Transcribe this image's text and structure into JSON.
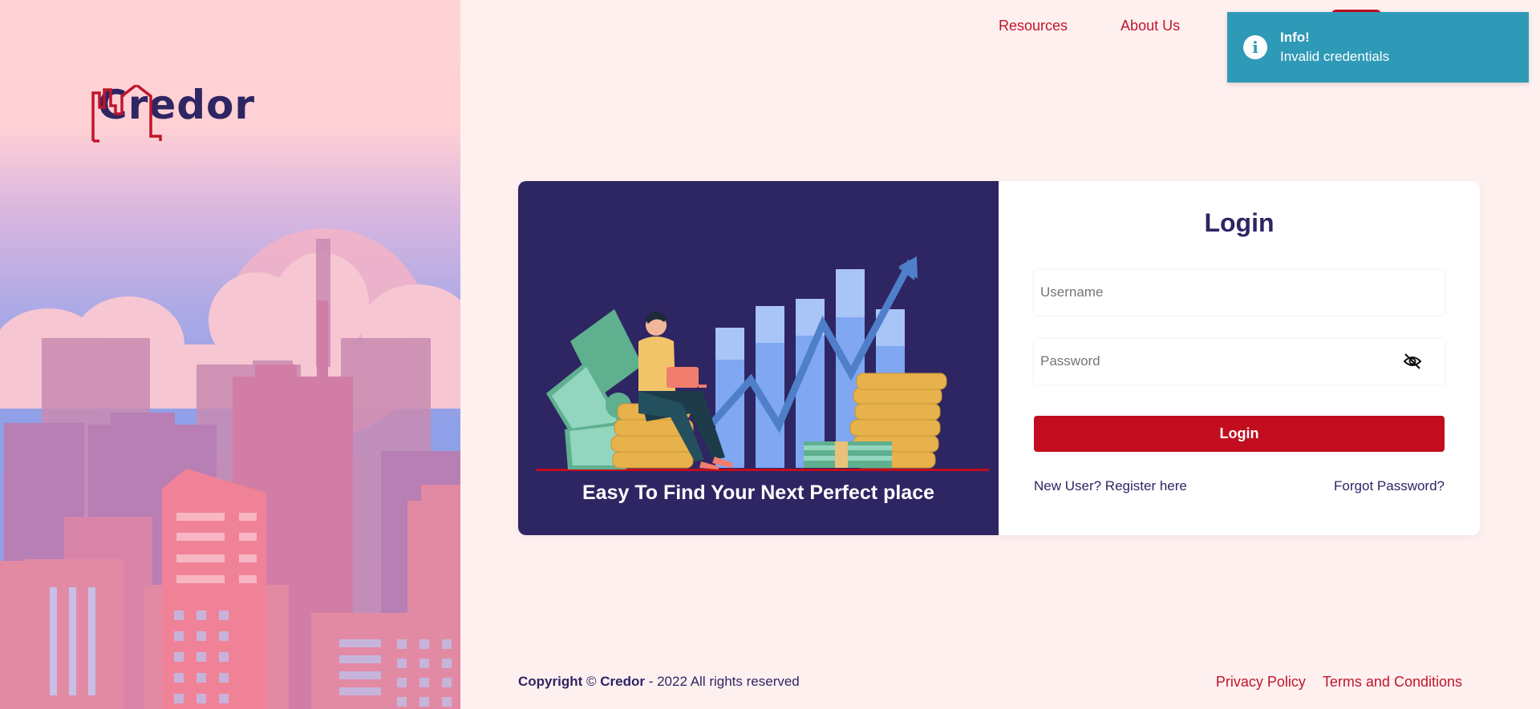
{
  "brand": {
    "name": "Credor"
  },
  "nav": {
    "items": [
      "Resources",
      "About Us"
    ]
  },
  "toast": {
    "title": "Info!",
    "message": "Invalid credentials",
    "icon": "info-icon"
  },
  "card": {
    "tagline": "Easy To Find Your Next Perfect place",
    "login_title": "Login",
    "username_placeholder": "Username",
    "password_placeholder": "Password",
    "login_button": "Login",
    "register_link": "New User? Register here",
    "forgot_link": "Forgot Password?"
  },
  "footer": {
    "copyright_bold": "Copyright",
    "copyright_symbol": " © ",
    "company": "Credor",
    "rights": " - 2022 All rights reserved",
    "links": [
      "Privacy Policy",
      "Terms and Conditions"
    ]
  },
  "colors": {
    "primary": "#c10d1d",
    "navy": "#2e2563",
    "toast": "#2f9ab7",
    "background": "#fff0f0"
  }
}
